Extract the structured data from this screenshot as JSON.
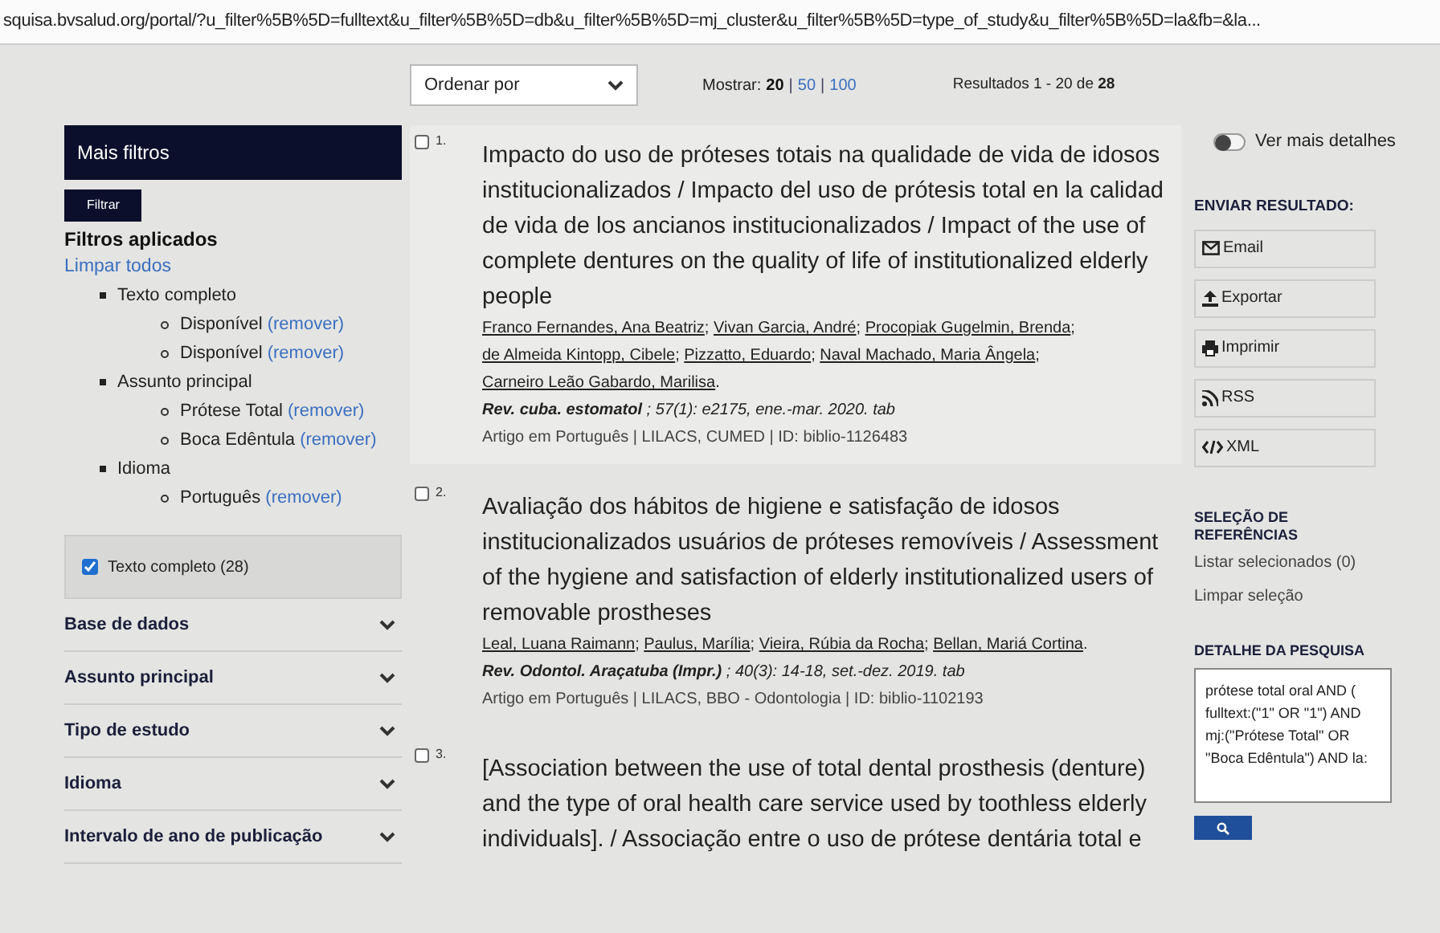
{
  "address_bar": {
    "url": "squisa.bvsalud.org/portal/?u_filter%5B%5D=fulltext&u_filter%5B%5D=db&u_filter%5B%5D=mj_cluster&u_filter%5B%5D=type_of_study&u_filter%5B%5D=la&fb=&la..."
  },
  "toolbar": {
    "sort": {
      "value": "Ordenar por"
    },
    "show_label": "Mostrar:",
    "separator": "|",
    "page_sizes": [
      {
        "label": "20",
        "selected": true
      },
      {
        "label": "50",
        "selected": false
      },
      {
        "label": "100",
        "selected": false
      }
    ],
    "results_text": "Resultados 1 - 20 de **28**"
  },
  "sidebar": {
    "header": "Mais filtros",
    "filter_button": "Filtrar",
    "applied_title": "Filtros aplicados",
    "clear_all": "Limpar todos",
    "applied": [
      {
        "label": "Texto completo",
        "children": [
          {
            "label": "Disponível",
            "remove": "(remover)"
          },
          {
            "label": "Disponível",
            "remove": "(remover)"
          }
        ]
      },
      {
        "label": "Assunto principal",
        "children": [
          {
            "label": "Prótese Total",
            "remove": "(remover)"
          },
          {
            "label": "Boca Edêntula",
            "remove": "(remover)"
          }
        ]
      },
      {
        "label": "Idioma",
        "children": [
          {
            "label": "Português",
            "remove": "(remover)"
          }
        ]
      }
    ],
    "checkbox": {
      "label": "Texto completo (28)",
      "checked": true
    },
    "facets": [
      {
        "label": "Base de dados",
        "expanded": false
      },
      {
        "label": "Assunto principal",
        "expanded": false
      },
      {
        "label": "Tipo de estudo",
        "expanded": false
      },
      {
        "label": "Idioma",
        "expanded": false
      },
      {
        "label": "Intervalo de ano de publicação",
        "expanded": false
      }
    ]
  },
  "results": [
    {
      "number": "1.",
      "checked": false,
      "title": "Impacto do uso de próteses totais na qualidade de vida de idosos institucionalizados / Impacto del uso de prótesis total en la calidad de vida de los ancianos institucionalizados / Impact of the use of complete dentures on the quality of life of institutionalized elderly people",
      "authors": [
        {
          "name": "Franco Fernandes, Ana Beatriz",
          "sep": ";"
        },
        {
          "name": "Vivan Garcia, André",
          "sep": ";"
        },
        {
          "name": "Procopiak Gugelmin, Brenda",
          "sep": ";"
        },
        {
          "name": "de Almeida Kintopp, Cibele",
          "sep": ";"
        },
        {
          "name": "Pizzatto, Eduardo",
          "sep": ";"
        },
        {
          "name": "Naval Machado, Maria Ângela",
          "sep": ";"
        },
        {
          "name": "Carneiro Leão Gabardo, Marilisa",
          "sep": "."
        }
      ],
      "source": "**Rev. cuba. estomatol** ; 57(1): e2175, ene.-mar. 2020. tab",
      "meta": "Artigo em Português | LILACS, CUMED | ID: biblio-1126483"
    },
    {
      "number": "2.",
      "checked": false,
      "title": "Avaliação dos hábitos de higiene e satisfação de idosos institucionalizados usuários de próteses removíveis / Assessment of the hygiene and satisfaction of elderly institutionalized users of removable prostheses",
      "authors": [
        {
          "name": "Leal, Luana Raimann",
          "sep": ";"
        },
        {
          "name": "Paulus, Marília",
          "sep": ";"
        },
        {
          "name": "Vieira, Rúbia da Rocha",
          "sep": ";"
        },
        {
          "name": "Bellan, Mariá Cortina",
          "sep": "."
        }
      ],
      "source": "**Rev. Odontol. Araçatuba (Impr.)** ; 40(3): 14-18, set.-dez. 2019. tab",
      "meta": "Artigo em Português | LILACS, BBO - Odontologia | ID: biblio-1102193"
    },
    {
      "number": "3.",
      "checked": false,
      "title": "[Association between the use of total dental prosthesis (denture) and the type of oral health care service used by toothless elderly individuals]. / Associação entre o uso de prótese dentária total e"
    }
  ],
  "right": {
    "details_toggle": {
      "label": "Ver mais detalhes",
      "on": false
    },
    "send_title": "ENVIAR RESULTADO:",
    "send_buttons": [
      {
        "kind": "email",
        "label": "Email"
      },
      {
        "kind": "export",
        "label": "Exportar"
      },
      {
        "kind": "print",
        "label": "Imprimir"
      },
      {
        "kind": "rss",
        "label": "RSS"
      },
      {
        "kind": "xml",
        "label": "XML"
      }
    ],
    "selection_title": "SELEÇÃO DE REFERÊNCIAS",
    "selection_links": [
      "Listar selecionados (0)",
      "Limpar seleção"
    ],
    "detail_title": "DETALHE DA PESQUISA",
    "query": "prótese total oral AND ( fulltext:(\"1\" OR \"1\") AND mj:(\"Prótese Total\" OR \"Boca Edêntula\") AND la:"
  }
}
